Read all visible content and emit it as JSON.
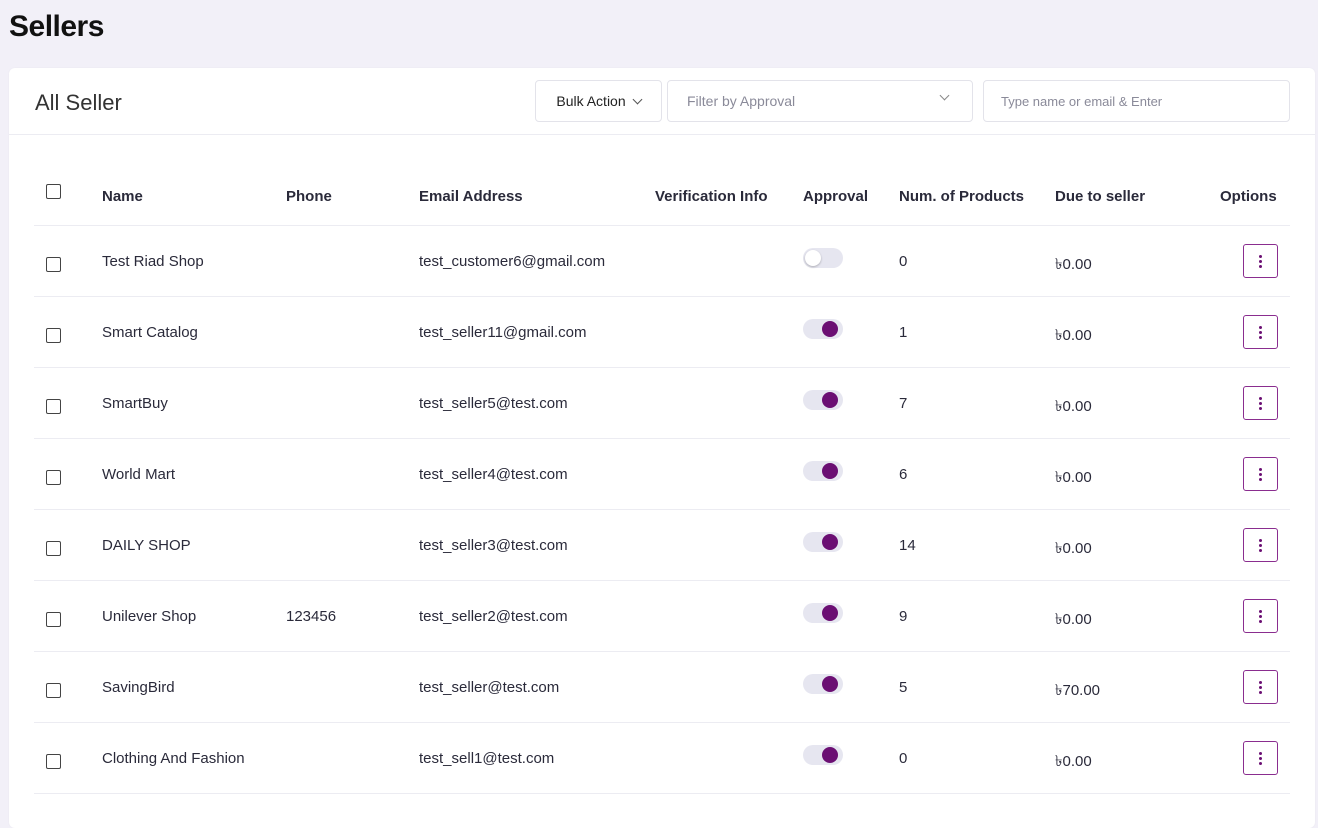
{
  "page": {
    "title": "Sellers"
  },
  "card": {
    "title": "All Seller",
    "bulk_action_label": "Bulk Action",
    "filter_placeholder": "Filter by Approval",
    "search_placeholder": "Type name or email & Enter"
  },
  "table": {
    "headers": {
      "name": "Name",
      "phone": "Phone",
      "email": "Email Address",
      "verification": "Verification Info",
      "approval": "Approval",
      "products": "Num. of Products",
      "due": "Due to seller",
      "options": "Options"
    },
    "rows": [
      {
        "name": "Test Riad Shop",
        "phone": "",
        "email": "test_customer6@gmail.com",
        "verification": "",
        "approved": false,
        "products": "0",
        "due": "৳0.00"
      },
      {
        "name": "Smart Catalog",
        "phone": "",
        "email": "test_seller11@gmail.com",
        "verification": "",
        "approved": true,
        "products": "1",
        "due": "৳0.00"
      },
      {
        "name": "SmartBuy",
        "phone": "",
        "email": "test_seller5@test.com",
        "verification": "",
        "approved": true,
        "products": "7",
        "due": "৳0.00"
      },
      {
        "name": "World Mart",
        "phone": "",
        "email": "test_seller4@test.com",
        "verification": "",
        "approved": true,
        "products": "6",
        "due": "৳0.00"
      },
      {
        "name": "DAILY SHOP",
        "phone": "",
        "email": "test_seller3@test.com",
        "verification": "",
        "approved": true,
        "products": "14",
        "due": "৳0.00"
      },
      {
        "name": "Unilever Shop",
        "phone": "123456",
        "email": "test_seller2@test.com",
        "verification": "",
        "approved": true,
        "products": "9",
        "due": "৳0.00"
      },
      {
        "name": "SavingBird",
        "phone": "",
        "email": "test_seller@test.com",
        "verification": "",
        "approved": true,
        "products": "5",
        "due": "৳70.00"
      },
      {
        "name": "Clothing And Fashion",
        "phone": "",
        "email": "test_sell1@test.com",
        "verification": "",
        "approved": true,
        "products": "0",
        "due": "৳0.00"
      }
    ]
  },
  "colors": {
    "accent": "#6b0f73",
    "page_bg": "#f2f0f8",
    "toggle_track": "#e6e6f0"
  },
  "icons": {
    "dropdown": "chevron-down-icon",
    "options": "more-vertical-icon"
  }
}
